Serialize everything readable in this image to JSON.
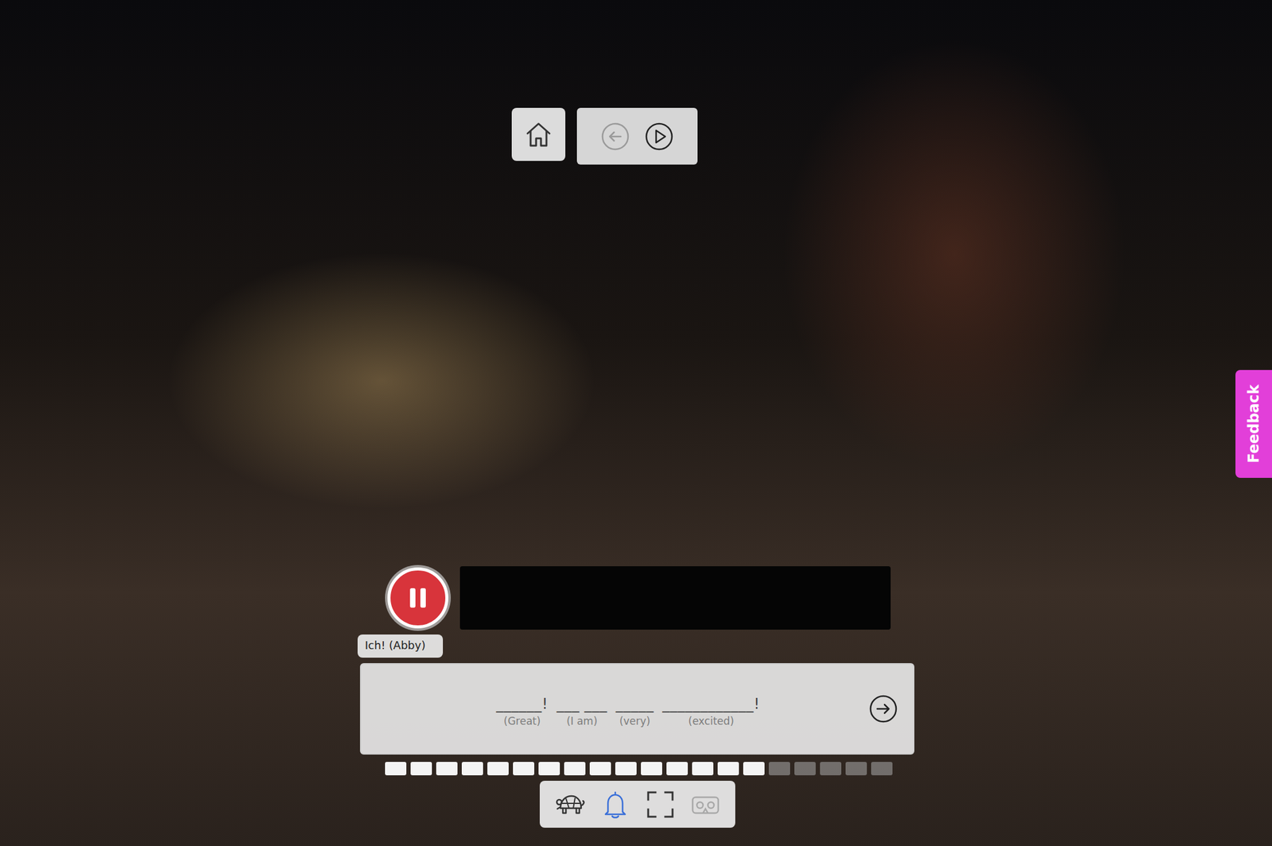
{
  "video": {
    "playing": true
  },
  "nav": {
    "buttons": [
      {
        "kind": "back",
        "disabled": true
      },
      {
        "kind": "play",
        "disabled": false
      }
    ]
  },
  "speaker": {
    "label": "Ich! (Abby)"
  },
  "exercise": {
    "blanks": [
      {
        "text": "______!",
        "hint": "(Great)"
      },
      {
        "text": "___ ___",
        "hint": "(I am)"
      },
      {
        "text": "_____",
        "hint": "(very)"
      },
      {
        "text": "____________!",
        "hint": "(excited)"
      }
    ]
  },
  "progress": {
    "segments": [
      {
        "done": true
      },
      {
        "done": true
      },
      {
        "done": true
      },
      {
        "done": true
      },
      {
        "done": true
      },
      {
        "done": true
      },
      {
        "done": true
      },
      {
        "done": true
      },
      {
        "done": true
      },
      {
        "done": true
      },
      {
        "done": true
      },
      {
        "done": true
      },
      {
        "done": true
      },
      {
        "done": true
      },
      {
        "done": true
      },
      {
        "done": false
      },
      {
        "done": false
      },
      {
        "done": false
      },
      {
        "done": false
      },
      {
        "done": false
      }
    ]
  },
  "toolbar": [
    {
      "kind": "turtle",
      "active": false,
      "disabled": false
    },
    {
      "kind": "bell",
      "active": true,
      "disabled": false
    },
    {
      "kind": "fullscreen",
      "active": false,
      "disabled": false
    },
    {
      "kind": "vr",
      "active": false,
      "disabled": true
    }
  ],
  "feedback": {
    "label": "Feedback"
  }
}
